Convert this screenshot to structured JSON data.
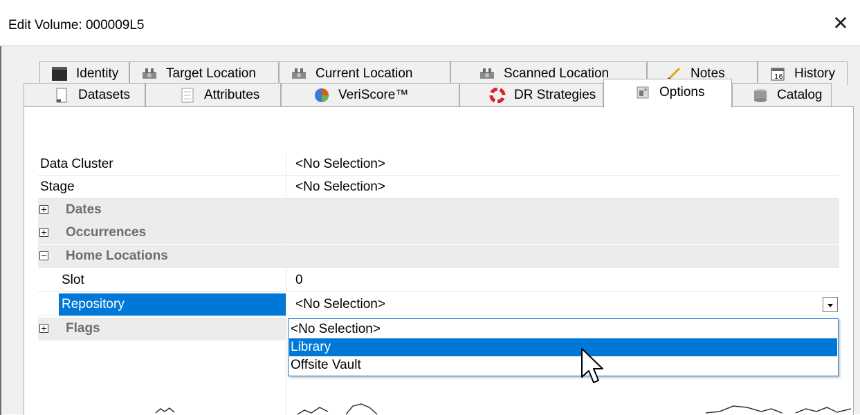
{
  "window": {
    "title": "Edit Volume: 000009L5"
  },
  "tabs_row1": [
    {
      "label": "Identity",
      "icon": "id-card-icon"
    },
    {
      "label": "Target Location",
      "icon": "robot-arm-icon"
    },
    {
      "label": "Current Location",
      "icon": "robot-arm-icon"
    },
    {
      "label": "Scanned Location",
      "icon": "robot-arm-icon"
    },
    {
      "label": "Notes",
      "icon": "pencil-icon"
    },
    {
      "label": "History",
      "icon": "calendar-icon"
    }
  ],
  "tabs_row2": [
    {
      "label": "Datasets",
      "icon": "document-icon"
    },
    {
      "label": "Attributes",
      "icon": "list-icon"
    },
    {
      "label": "VeriScore™",
      "icon": "pie-chart-icon"
    },
    {
      "label": "DR Strategies",
      "icon": "lifebuoy-icon"
    },
    {
      "label": "Options",
      "icon": "options-icon",
      "active": true
    },
    {
      "label": "Catalog",
      "icon": "database-icon"
    }
  ],
  "properties": {
    "data_cluster": {
      "name": "Data Cluster",
      "value": "<No Selection>"
    },
    "stage": {
      "name": "Stage",
      "value": "<No Selection>"
    },
    "dates": {
      "name": "Dates"
    },
    "occurrences": {
      "name": "Occurrences"
    },
    "home_locations": {
      "name": "Home Locations"
    },
    "slot": {
      "name": "Slot",
      "value": "0"
    },
    "repository": {
      "name": "Repository",
      "value": "<No Selection>"
    },
    "flags": {
      "name": "Flags"
    }
  },
  "dropdown": {
    "options": [
      "<No Selection>",
      "Library",
      "Offsite Vault"
    ],
    "highlighted": "Library"
  },
  "colors": {
    "selection": "#0078d7",
    "category_bg": "#ececec"
  }
}
